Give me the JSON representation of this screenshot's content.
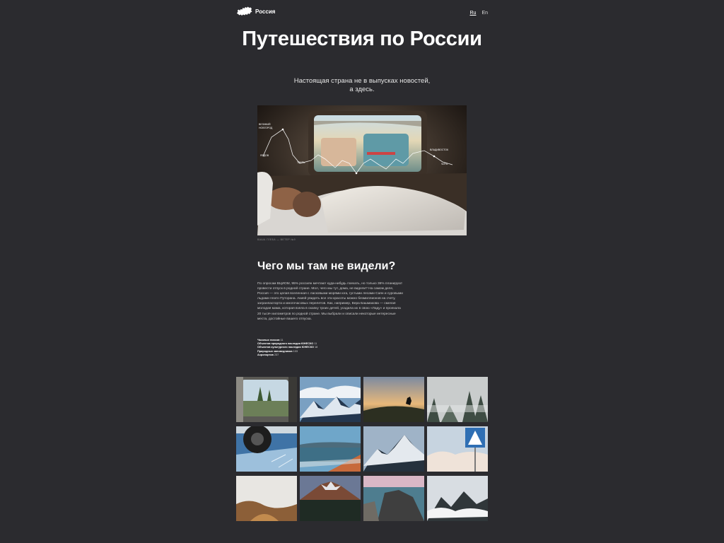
{
  "header": {
    "logo_icon": "russia-map-icon",
    "site_name": "Россия",
    "languages": [
      {
        "label": "Ru",
        "active": true
      },
      {
        "label": "En",
        "active": false
      }
    ]
  },
  "hero": {
    "title": "Путешествия по России",
    "subtitle": "Настоящая страна не в выпусках новостей, а здесь.",
    "image_caption": "Ваша Глеба — Ветер №9",
    "image_alt": "sleeping-passenger-train-window-photo"
  },
  "section": {
    "title": "Чего мы там не видели?",
    "body": "По опросам ВЦИОМ, 95% россиян мечтают куда-нибудь поехать, но только 36% планируют провести отпуск в родной стране. Мол, чего мы тут, дома, не видели? На самом деле, Россия — это целая вселенная с ласковыми морями юга, густыми лесами Саян и суровыми льдами плато Путорана. Акией увидеть все эти красоты можно безмиллионов на счету, загранпаспорта и многочасовых перелетов. Как, например, Вера Башмакова — смелая молодая мама, которая взяла в охапку троих детей, усадила их в свою «Ладу» и проехала 20 тысяч километров по родной стране. Мы выбрали и описали некоторые интересные места, достойные вашего отпуска.",
    "stats": [
      {
        "label": "Часовых поясов",
        "value": "11"
      },
      {
        "label": "Объектов природного наследия ЮНЕСКО",
        "value": "11"
      },
      {
        "label": "Объектов культурного наследия ЮНЕСКО",
        "value": "18"
      },
      {
        "label": "Природных заповедников",
        "value": "103"
      },
      {
        "label": "Аэропортов",
        "value": "237"
      }
    ]
  },
  "gallery": {
    "items": [
      {
        "name": "train-window-photo"
      },
      {
        "name": "snowy-mountains-photo"
      },
      {
        "name": "wolf-on-hill-photo"
      },
      {
        "name": "foggy-forest-photo"
      },
      {
        "name": "car-wheel-on-ice-photo"
      },
      {
        "name": "lake-shore-photo"
      },
      {
        "name": "snowy-peak-photo"
      },
      {
        "name": "crosswalk-sign-photo"
      },
      {
        "name": "geyser-valley-photo"
      },
      {
        "name": "volcano-photo"
      },
      {
        "name": "coastal-cliffs-photo"
      },
      {
        "name": "clouds-over-mountains-photo"
      }
    ]
  }
}
